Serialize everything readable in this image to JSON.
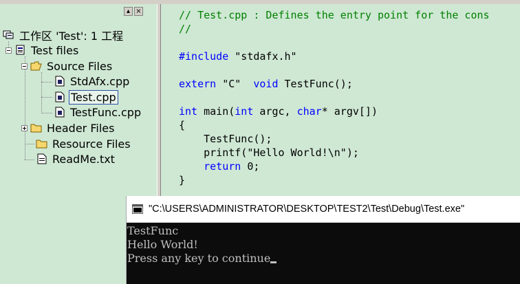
{
  "workspace": {
    "title": "工作区 'Test': 1 工程",
    "project": "Test files",
    "source_folder": "Source Files",
    "source_files": [
      "StdAfx.cpp",
      "Test.cpp",
      "TestFunc.cpp"
    ],
    "header_folder": "Header Files",
    "resource_folder": "Resource Files",
    "readme": "ReadMe.txt",
    "minimize_glyph": "▴",
    "close_glyph": "×"
  },
  "editor": {
    "lines": [
      {
        "t": "c",
        "s": "// Test.cpp : Defines the entry point for the cons"
      },
      {
        "t": "c",
        "s": "//"
      },
      {
        "t": "p",
        "s": ""
      },
      {
        "t": "mix",
        "a": "#include",
        "b": " \"stdafx.h\""
      },
      {
        "t": "p",
        "s": ""
      },
      {
        "t": "mix",
        "a": "extern",
        "b": " \"C\"  ",
        "c": "void",
        "d": " TestFunc();"
      },
      {
        "t": "p",
        "s": ""
      },
      {
        "t": "main"
      },
      {
        "t": "p",
        "s": "{"
      },
      {
        "t": "p",
        "s": "    TestFunc();"
      },
      {
        "t": "p",
        "s": "    printf(\"Hello World!\\n\");"
      },
      {
        "t": "ret"
      },
      {
        "t": "p",
        "s": "}"
      }
    ]
  },
  "console": {
    "title": "\"C:\\USERS\\ADMINISTRATOR\\DESKTOP\\TEST2\\Test\\Debug\\Test.exe\"",
    "output": [
      "TestFunc",
      "Hello World!",
      "Press any key to continue"
    ]
  },
  "colors": {
    "background": "#cfe8d4",
    "comment": "#008000",
    "keyword": "#0000ff",
    "console_bg": "#0c0c0c"
  }
}
